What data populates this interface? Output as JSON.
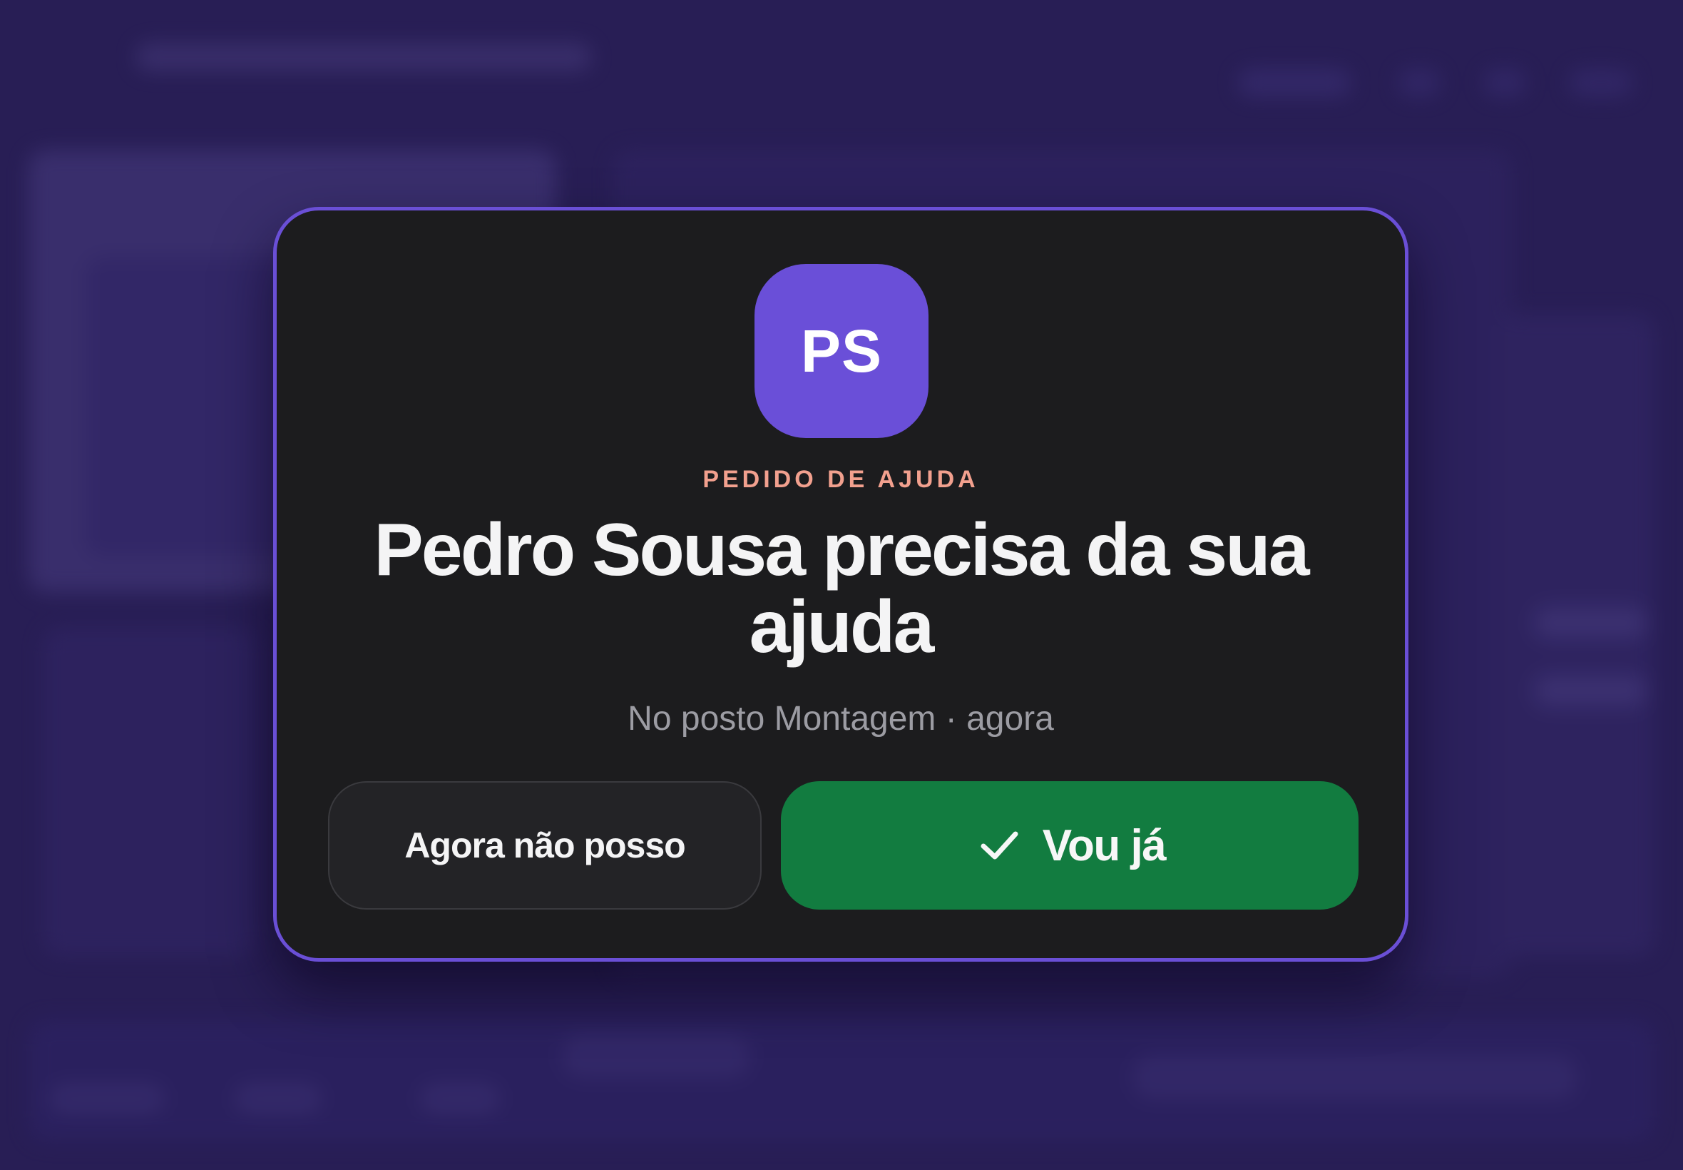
{
  "notification": {
    "avatar_initials": "PS",
    "eyebrow": "PEDIDO DE AJUDA",
    "title": "Pedro Sousa precisa da sua ajuda",
    "subtitle": "No posto Montagem · agora"
  },
  "actions": {
    "decline_label": "Agora não posso",
    "accept_label": "Vou já",
    "accept_icon": "check-icon"
  },
  "colors": {
    "background": "#281e55",
    "modal_bg": "#1c1c1e",
    "modal_border": "#6a4fd6",
    "avatar_bg": "#6a4fd8",
    "eyebrow": "#f2a08e",
    "accept_bg": "#127c40"
  }
}
